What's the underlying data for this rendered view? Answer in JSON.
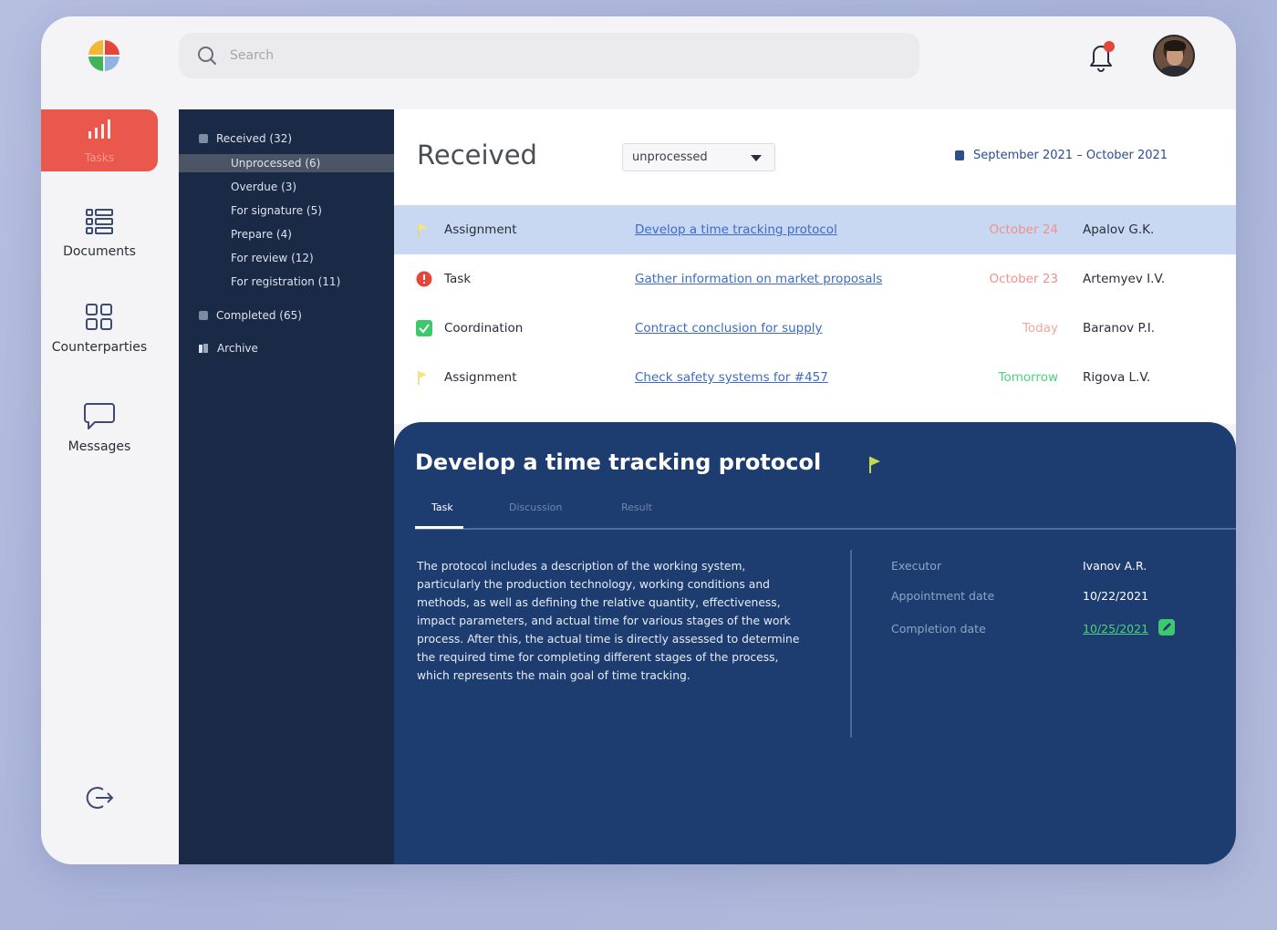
{
  "search": {
    "placeholder": "Search"
  },
  "nav": {
    "items": [
      {
        "label": "Tasks",
        "icon": "bar-chart-icon"
      },
      {
        "label": "Documents",
        "icon": "list-icon"
      },
      {
        "label": "Counterparties",
        "icon": "grid-icon"
      },
      {
        "label": "Messages",
        "icon": "chat-bubble-icon"
      }
    ],
    "logout_icon": "logout-icon"
  },
  "folders": {
    "received": "Received (32)",
    "sub": [
      "Unprocessed (6)",
      "Overdue (3)",
      "For signature (5)",
      "Prepare (4)",
      "For review (12)",
      "For registration (11)"
    ],
    "completed": "Completed (65)",
    "archive": "Archive"
  },
  "main": {
    "title": "Received",
    "filter_value": "unprocessed",
    "date_range": "September 2021 – October 2021",
    "rows": [
      {
        "type": "Assignment",
        "subject": "Develop a time tracking protocol",
        "date": "October 24",
        "date_color": "#f2908a",
        "person": "Apalov G.K.",
        "icon": "flag-icon",
        "icon_color": "#f5e57a"
      },
      {
        "type": "Task",
        "subject": "Gather information on market proposals",
        "date": "October 23",
        "date_color": "#f2908a",
        "person": "Artemyev I.V.",
        "icon": "alert-icon",
        "icon_color": "#e6463a"
      },
      {
        "type": "Coordination",
        "subject": "Contract conclusion for supply",
        "date": "Today",
        "date_color": "#f6a49c",
        "person": "Baranov P.I.",
        "icon": "check-icon",
        "icon_color": "#3ec86b"
      },
      {
        "type": "Assignment",
        "subject": "Check safety systems for #457",
        "date": "Tomorrow",
        "date_color": "#4ed17a",
        "person": "Rigova L.V.",
        "icon": "flag-icon",
        "icon_color": "#f5e57a"
      }
    ]
  },
  "detail": {
    "title": "Develop a time tracking protocol",
    "tabs": [
      "Task",
      "Discussion",
      "Result"
    ],
    "description": "The protocol includes a description of the working system, particularly the production technology, working conditions and methods, as well as defining the relative quantity, effectiveness, impact parameters, and actual time for various stages of the work process. After this, the actual time is directly assessed to determine the required time for completing different stages of the process, which represents the main goal of time tracking.",
    "fields": [
      {
        "label": "Executor",
        "value": "Ivanov A.R."
      },
      {
        "label": "Appointment date",
        "value": "10/22/2021"
      },
      {
        "label": "Completion date",
        "value": "10/25/2021"
      }
    ]
  },
  "colors": {
    "accent_red": "#e9574d",
    "dark_navy": "#1a2a46",
    "detail_blue": "#1d3d70",
    "link_blue": "#3d6bc2"
  }
}
